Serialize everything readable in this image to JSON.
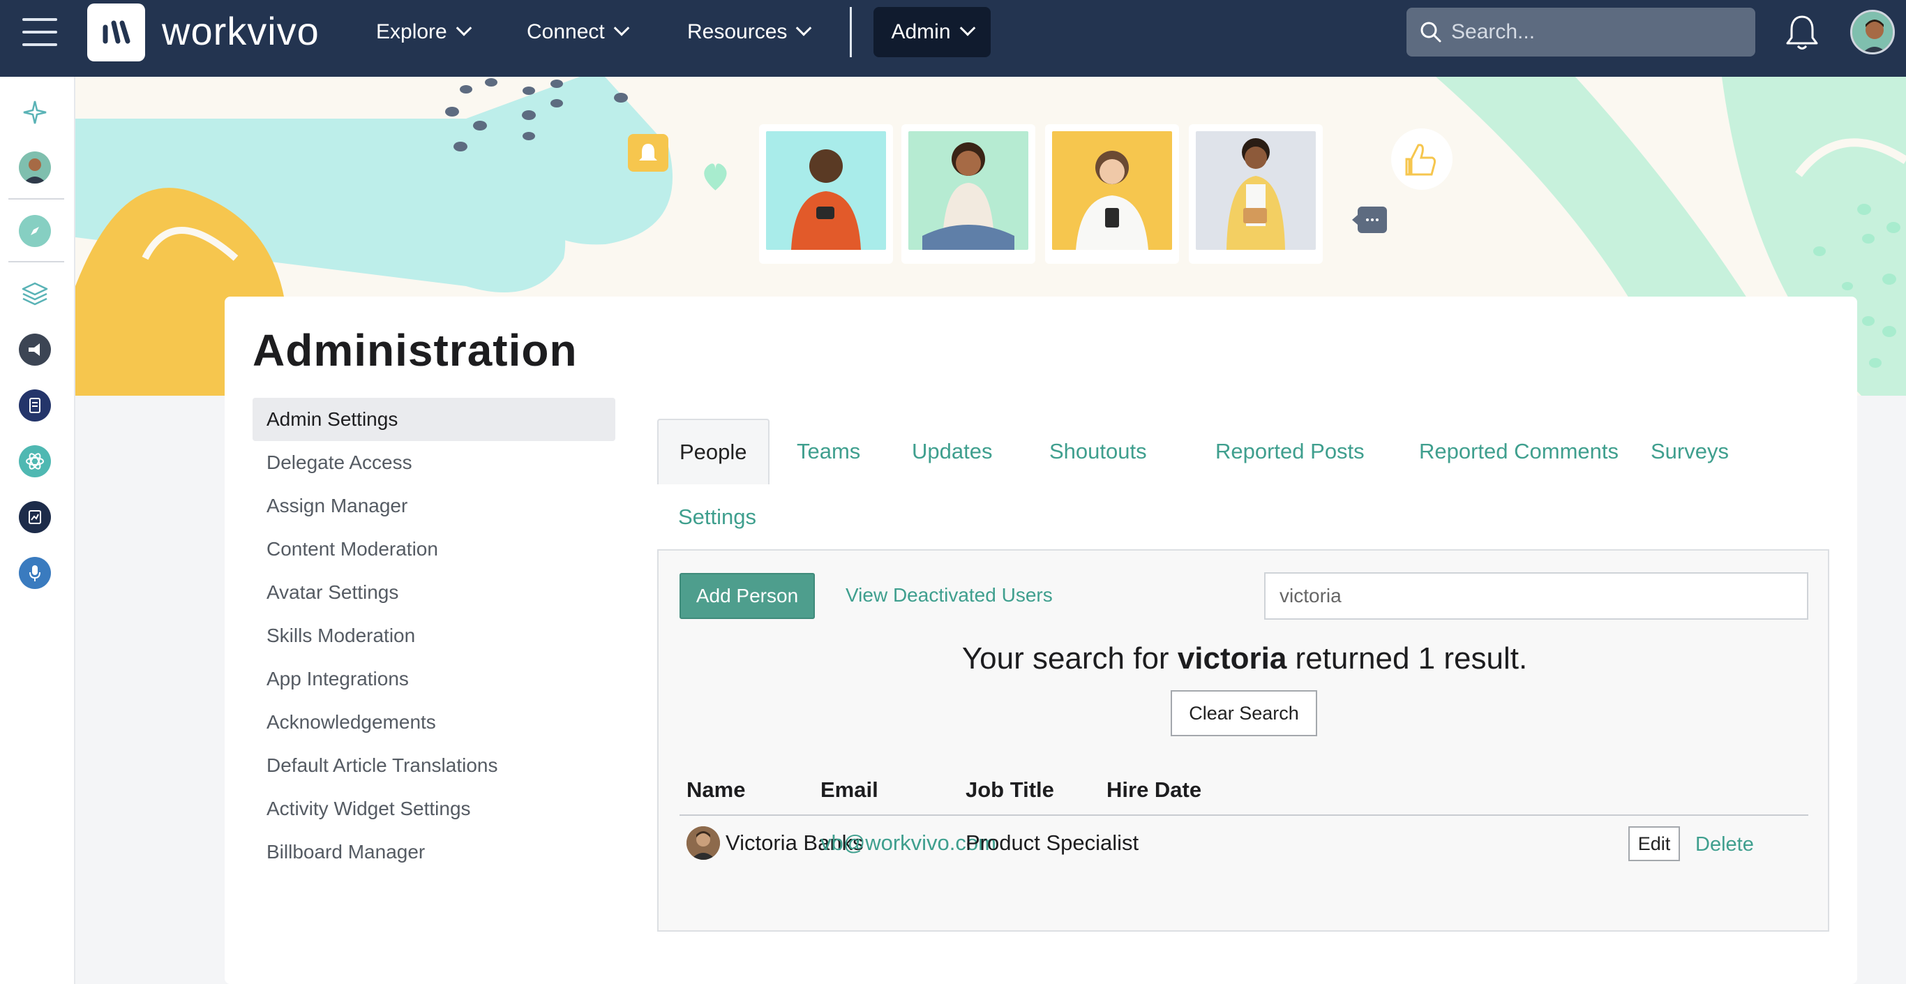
{
  "app": {
    "brand": "workvivo"
  },
  "nav": {
    "items": [
      {
        "label": "Explore"
      },
      {
        "label": "Connect"
      },
      {
        "label": "Resources"
      }
    ],
    "admin_label": "Admin",
    "search_placeholder": "Search..."
  },
  "rail": {
    "icons": [
      "sparkle-icon",
      "profile-avatar",
      "compass-icon",
      "layers-icon",
      "megaphone-icon",
      "document-icon",
      "atom-icon",
      "chart-icon",
      "microphone-icon"
    ]
  },
  "page": {
    "title": "Administration"
  },
  "side_menu": {
    "items": [
      {
        "label": "Admin Settings"
      },
      {
        "label": "Delegate Access"
      },
      {
        "label": "Assign Manager"
      },
      {
        "label": "Content Moderation"
      },
      {
        "label": "Avatar Settings"
      },
      {
        "label": "Skills Moderation"
      },
      {
        "label": "App Integrations"
      },
      {
        "label": "Acknowledgements"
      },
      {
        "label": "Default Article Translations"
      },
      {
        "label": "Activity Widget Settings"
      },
      {
        "label": "Billboard Manager"
      }
    ],
    "active_index": 0
  },
  "tabs": {
    "items": [
      {
        "label": "People"
      },
      {
        "label": "Teams"
      },
      {
        "label": "Updates"
      },
      {
        "label": "Shoutouts"
      },
      {
        "label": "Reported Posts"
      },
      {
        "label": "Reported Comments"
      },
      {
        "label": "Surveys"
      },
      {
        "label": "Settings"
      }
    ],
    "active": "People"
  },
  "people": {
    "add_label": "Add Person",
    "deactivated_label": "View Deactivated Users",
    "search_value": "victoria",
    "result_prefix": "Your search for ",
    "result_term": "victoria",
    "result_suffix": " returned 1 result.",
    "clear_label": "Clear Search",
    "columns": [
      "Name",
      "Email",
      "Job Title",
      "Hire Date"
    ],
    "rows": [
      {
        "name": "Victoria Banks",
        "email": "vb@workvivo.com",
        "job_title": "Product Specialist",
        "hire_date": "",
        "edit_label": "Edit",
        "delete_label": "Delete"
      }
    ]
  },
  "colors": {
    "nav_bg": "#233450",
    "accent": "#3f9f8e",
    "button_green": "#4e9e8d",
    "banner_teal": "#bdeeea",
    "banner_yellow": "#f6c64e",
    "banner_mint": "#c7f1dc"
  }
}
